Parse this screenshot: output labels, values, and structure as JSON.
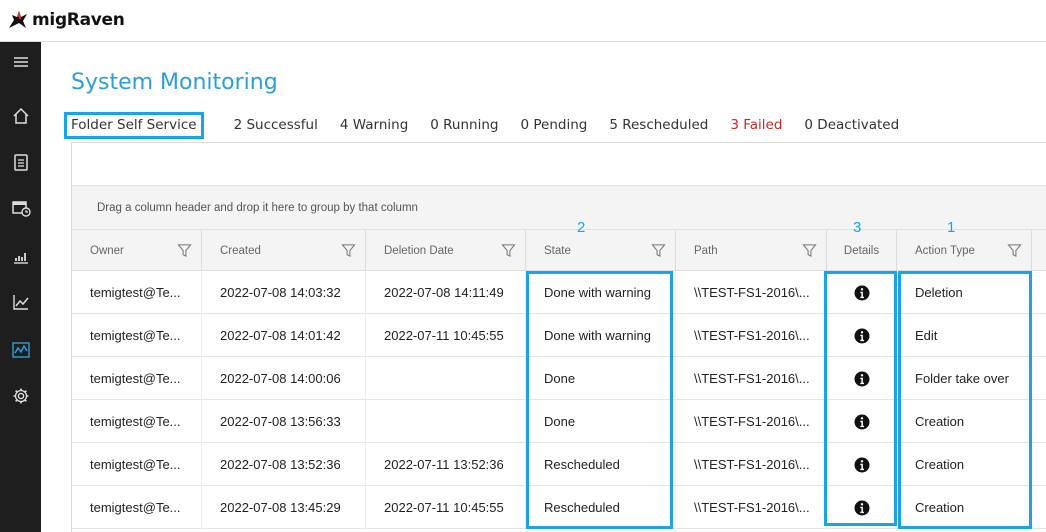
{
  "app": {
    "name": "migRaven"
  },
  "sidebar": {
    "items": [
      {
        "icon": "menu-icon"
      },
      {
        "icon": "home-icon"
      },
      {
        "icon": "clipboard-icon"
      },
      {
        "icon": "scheduled-report-icon"
      },
      {
        "icon": "bar-chart-icon"
      },
      {
        "icon": "trend-chart-icon"
      },
      {
        "icon": "monitoring-icon",
        "active": true
      },
      {
        "icon": "gear-icon"
      }
    ]
  },
  "page": {
    "title": "System Monitoring"
  },
  "filter_bar": {
    "active_filter": "Folder Self Service",
    "stats": {
      "successful": "2 Successful",
      "warning": "4 Warning",
      "running": "0 Running",
      "pending": "0 Pending",
      "rescheduled": "5 Rescheduled",
      "failed": "3 Failed",
      "deactivated": "0 Deactivated"
    }
  },
  "grid": {
    "group_panel_text": "Drag a column header and drop it here to group by that column",
    "columns": {
      "owner": "Owner",
      "created": "Created",
      "deletion_date": "Deletion Date",
      "state": "State",
      "path": "Path",
      "details": "Details",
      "action_type": "Action Type"
    },
    "rows": [
      {
        "owner": "temigtest@Te...",
        "created": "2022-07-08 14:03:32",
        "deletion_date": "2022-07-08 14:11:49",
        "state": "Done with warning",
        "path": "\\\\TEST-FS1-2016\\...",
        "action_type": "Deletion"
      },
      {
        "owner": "temigtest@Te...",
        "created": "2022-07-08 14:01:42",
        "deletion_date": "2022-07-11 10:45:55",
        "state": "Done with warning",
        "path": "\\\\TEST-FS1-2016\\...",
        "action_type": "Edit"
      },
      {
        "owner": "temigtest@Te...",
        "created": "2022-07-08 14:00:06",
        "deletion_date": "",
        "state": "Done",
        "path": "\\\\TEST-FS1-2016\\...",
        "action_type": "Folder take over"
      },
      {
        "owner": "temigtest@Te...",
        "created": "2022-07-08 13:56:33",
        "deletion_date": "",
        "state": "Done",
        "path": "\\\\TEST-FS1-2016\\...",
        "action_type": "Creation"
      },
      {
        "owner": "temigtest@Te...",
        "created": "2022-07-08 13:52:36",
        "deletion_date": "2022-07-11 13:52:36",
        "state": "Rescheduled",
        "path": "\\\\TEST-FS1-2016\\...",
        "action_type": "Creation"
      },
      {
        "owner": "temigtest@Te...",
        "created": "2022-07-08 13:45:29",
        "deletion_date": "2022-07-11 10:45:55",
        "state": "Rescheduled",
        "path": "\\\\TEST-FS1-2016\\...",
        "action_type": "Creation"
      }
    ]
  },
  "annotations": {
    "one": "1",
    "two": "2",
    "three": "3"
  },
  "colors": {
    "accent": "#2d9fd8",
    "highlight": "#1aa3e6",
    "failed": "#c62828",
    "sidebar": "#1e1e1e"
  }
}
